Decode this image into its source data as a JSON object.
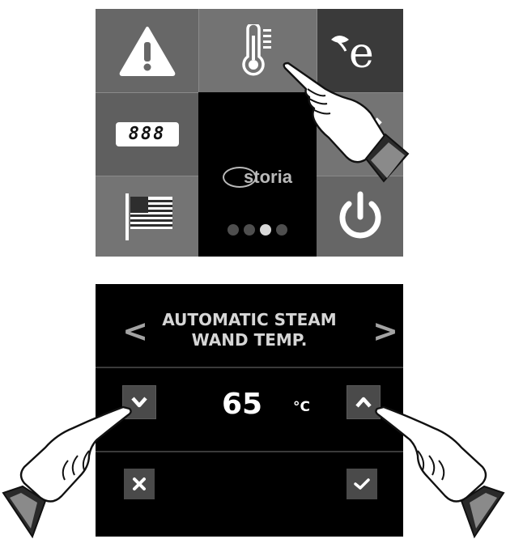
{
  "home": {
    "brand": "storia",
    "display_digits": "888",
    "pager": {
      "count": 4,
      "active": 3
    },
    "tiles": [
      {
        "name": "warning",
        "icon": "warning-icon"
      },
      {
        "name": "temperature",
        "icon": "thermometer-icon"
      },
      {
        "name": "eco",
        "icon": "eco-leaf-icon",
        "glyph": "e"
      },
      {
        "name": "display",
        "icon": "digit-display-icon"
      },
      {
        "name": "timer",
        "icon": "stopwatch-icon"
      },
      {
        "name": "language",
        "icon": "us-flag-icon"
      },
      {
        "name": "power",
        "icon": "power-icon"
      }
    ]
  },
  "steam": {
    "title_line1": "AUTOMATIC STEAM",
    "title_line2": "WAND TEMP.",
    "prev_glyph": "<",
    "next_glyph": ">",
    "value": "65",
    "unit": "°C",
    "icons": {
      "prev": "chevron-left-icon",
      "next": "chevron-right-icon",
      "decrease": "chevron-down-icon",
      "increase": "chevron-up-icon",
      "cancel": "close-icon",
      "confirm": "check-icon"
    }
  },
  "colors": {
    "panel": "#000000",
    "button": "#4a4a4a",
    "text": "#ffffff",
    "tile_dark": "#3a3a3a",
    "tile_mid": "#747474"
  }
}
